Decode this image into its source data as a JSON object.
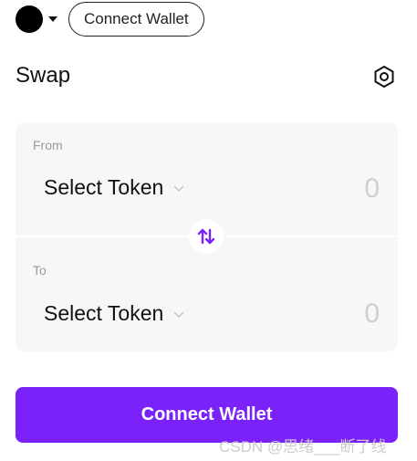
{
  "header": {
    "connect_label": "Connect Wallet"
  },
  "swap": {
    "title": "Swap",
    "settings_icon": "hexagon-settings-icon"
  },
  "from": {
    "label": "From",
    "token": "Select Token",
    "amount": "0"
  },
  "to": {
    "label": "To",
    "token": "Select Token",
    "amount": "0"
  },
  "actions": {
    "connect_wallet": "Connect Wallet"
  },
  "watermark": "CSDN @思绪___断了线",
  "colors": {
    "accent": "#7b22fb",
    "card_bg": "#f7f7f7",
    "muted_amount": "#cfcfcf"
  }
}
